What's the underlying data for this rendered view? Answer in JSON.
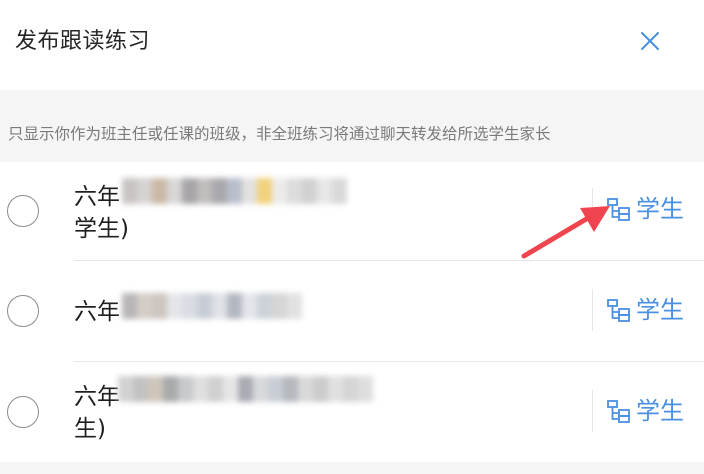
{
  "header": {
    "title": "发布跟读练习"
  },
  "notice": {
    "text": "只显示你作为班主任或任课的班级，非全班练习将通过聊天转发给所选学生家长"
  },
  "classes": [
    {
      "prefix": "六年",
      "suffix": "学生)",
      "students_label": "学生"
    },
    {
      "prefix": "六年",
      "suffix": "",
      "students_label": "学生"
    },
    {
      "prefix": "六年",
      "suffix": "生)",
      "students_label": "学生"
    }
  ],
  "colors": {
    "accent": "#4a90e2",
    "annotation_arrow": "#f0454e"
  }
}
